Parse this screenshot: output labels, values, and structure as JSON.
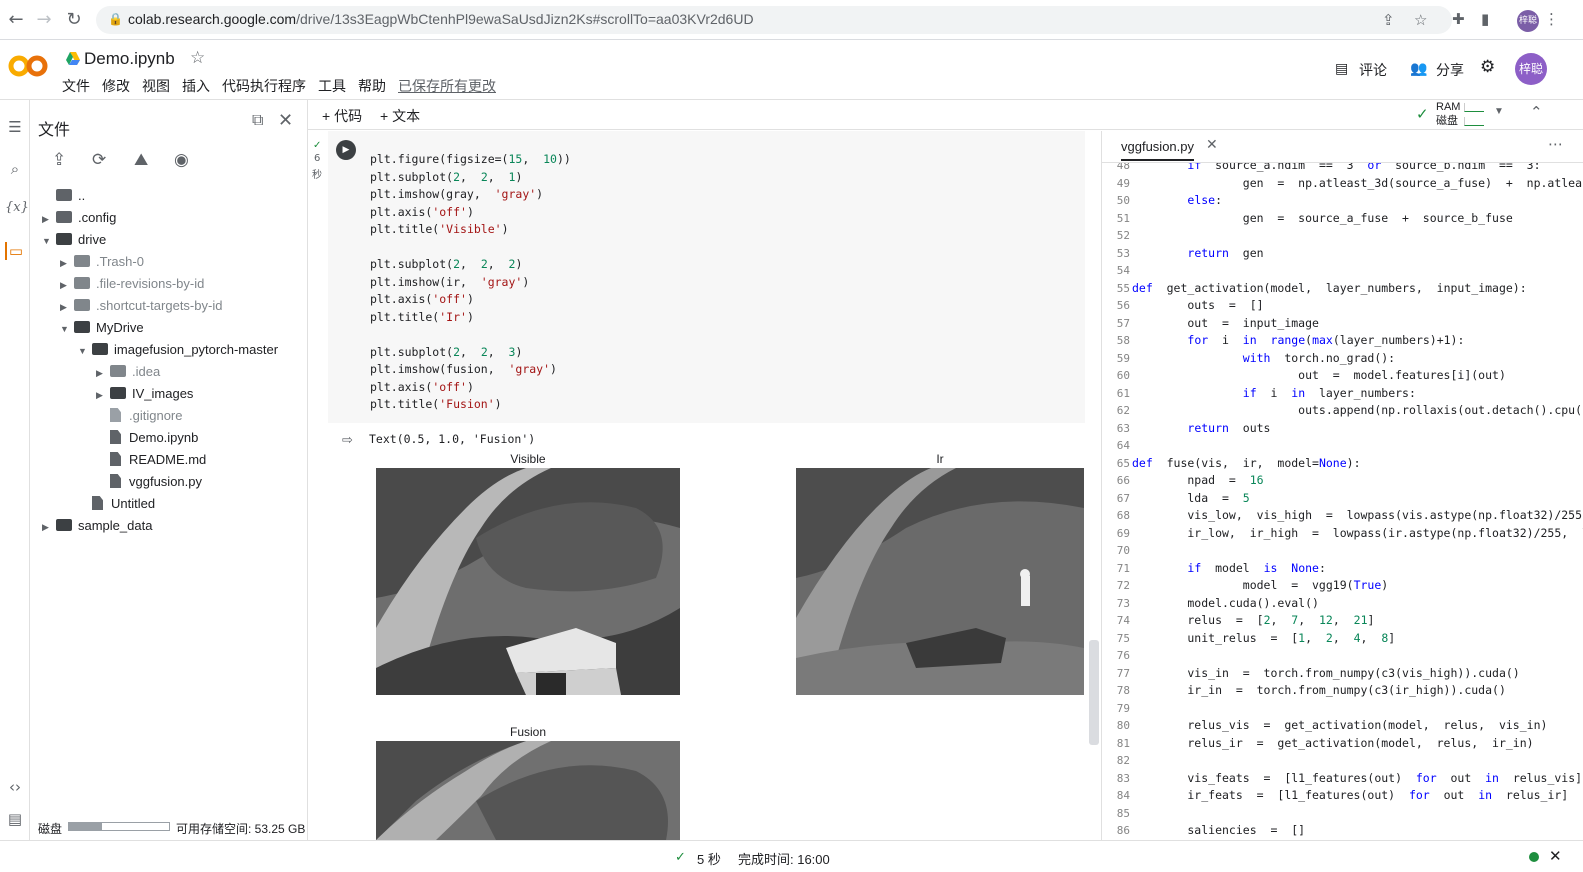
{
  "browser": {
    "url_host": "colab.research.google.com",
    "url_path": "/drive/13s3EagpWbCtenhPl9ewaSaUsdJizn2Ks#scrollTo=aa03KVr2d6UD",
    "profile_initials": "梓聪"
  },
  "colab": {
    "notebook_name": "Demo.ipynb",
    "menu": [
      "文件",
      "修改",
      "视图",
      "插入",
      "代码执行程序",
      "工具",
      "帮助"
    ],
    "saved_status": "已保存所有更改",
    "comment_label": "评论",
    "share_label": "分享",
    "avatar_initials": "梓聪"
  },
  "files_panel": {
    "title": "文件",
    "tree": [
      {
        "name": "..",
        "type": "up",
        "depth": 0
      },
      {
        "name": ".config",
        "type": "folder",
        "depth": 0,
        "arrow": "right"
      },
      {
        "name": "drive",
        "type": "folder",
        "depth": 0,
        "arrow": "down"
      },
      {
        "name": ".Trash-0",
        "type": "folder",
        "depth": 1,
        "arrow": "right"
      },
      {
        "name": ".file-revisions-by-id",
        "type": "folder",
        "depth": 1,
        "arrow": "right"
      },
      {
        "name": ".shortcut-targets-by-id",
        "type": "folder",
        "depth": 1,
        "arrow": "right"
      },
      {
        "name": "MyDrive",
        "type": "folder",
        "depth": 1,
        "arrow": "down"
      },
      {
        "name": "imagefusion_pytorch-master",
        "type": "folder",
        "depth": 2,
        "arrow": "down"
      },
      {
        "name": ".idea",
        "type": "folder",
        "depth": 3,
        "arrow": "right"
      },
      {
        "name": "IV_images",
        "type": "folder",
        "depth": 3,
        "arrow": "right"
      },
      {
        "name": ".gitignore",
        "type": "file",
        "depth": 3
      },
      {
        "name": "Demo.ipynb",
        "type": "file",
        "depth": 3
      },
      {
        "name": "README.md",
        "type": "file",
        "depth": 3
      },
      {
        "name": "vggfusion.py",
        "type": "file",
        "depth": 3
      },
      {
        "name": "Untitled",
        "type": "file",
        "depth": 2
      },
      {
        "name": "sample_data",
        "type": "folder",
        "depth": 0,
        "arrow": "right"
      }
    ],
    "disk_label": "磁盘",
    "disk_used_fraction": 0.33,
    "free_space": "可用存储空间: 53.25 GB"
  },
  "notebook": {
    "add_code": "+ 代码",
    "add_text": "+ 文本",
    "ram_label": "RAM",
    "disk_label": "磁盘",
    "exec_count": "6",
    "exec_unit": "秒",
    "output_text": "Text(0.5, 1.0, 'Fusion')",
    "image_titles": [
      "Visible",
      "Ir",
      "Fusion"
    ]
  },
  "editor": {
    "tab_name": "vggfusion.py",
    "first_line": 48
  },
  "status": {
    "duration": "5 秒",
    "completed": "完成时间: 16:00"
  }
}
